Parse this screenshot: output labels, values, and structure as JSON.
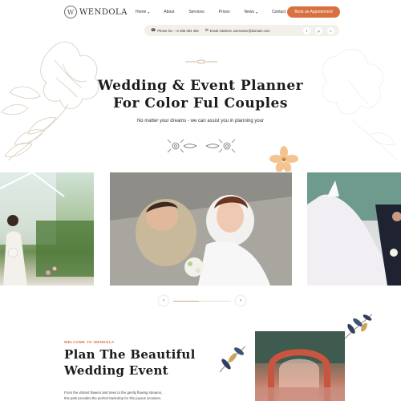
{
  "brand": {
    "name": "WENDOLA",
    "logo_letter": "W"
  },
  "nav": {
    "items": [
      {
        "label": "Home",
        "dropdown": true
      },
      {
        "label": "About",
        "dropdown": false
      },
      {
        "label": "Services",
        "dropdown": false
      },
      {
        "label": "Prices",
        "dropdown": false
      },
      {
        "label": "News",
        "dropdown": true
      },
      {
        "label": "Contact",
        "dropdown": false
      }
    ],
    "cta_label": "Book an Appointment"
  },
  "infobar": {
    "phone": "Phone No : +1 836 384 493",
    "email": "Email Address: username@domain.com",
    "socials": [
      "facebook",
      "pinterest",
      "twitter"
    ]
  },
  "hero": {
    "title_line1": "Wedding & Event Planner",
    "title_line2": "For Color Ful Couples",
    "subtitle": "No matter your dreams - we can assist you in planning your"
  },
  "slider": {
    "prev_icon": "chevron-left-icon",
    "next_icon": "chevron-right-icon",
    "progress": 0.45
  },
  "about": {
    "eyebrow": "WELCOME TO WENDOLA",
    "title_line1": "Plan The Beautiful",
    "title_line2": "Wedding Event",
    "desc_line1": "From the vibrant flowers and trees to the gently flowing streams,",
    "desc_line2": "this park provides the perfect backdrop for this joyous occasion."
  },
  "colors": {
    "accent": "#d9703f",
    "bar_bg": "#f3f0ea",
    "gold": "#c7a882"
  }
}
